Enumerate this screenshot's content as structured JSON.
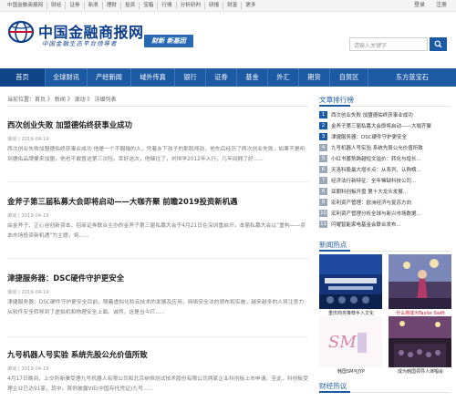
{
  "topbar": {
    "links": [
      "中国金融商报网",
      "财经",
      "证券",
      "新浪",
      "理财",
      "投资",
      "宝箱",
      "行情",
      "分析研判",
      "研报",
      "财富",
      "更多"
    ],
    "login": "登录",
    "register": "注册"
  },
  "header": {
    "site_name": "中国金融商报网",
    "slogan": "中国金融生态平台领导者",
    "badge": "财新 新基因",
    "search_placeholder": "请输入关键字"
  },
  "nav": {
    "items": [
      "首页",
      "全球财讯",
      "产经新闻",
      "域外传真",
      "银行",
      "证券",
      "基金",
      "外汇",
      "期货",
      "自贸区",
      "东方蓝宝石"
    ],
    "active_index": 0
  },
  "breadcrumb": "当前位置：首页 》 新闻 》 滚动 》 详细列表",
  "articles": [
    {
      "title": "西次创业失败 加盟德佑终获事业成功",
      "meta": "滚动 | 2019-04-19",
      "excerpt": "西次创业失败加盟德佑终获事业成功 他是一个不服输的人，凭着乡下孩子的那股闯劲，他先后经历了两次创业失败，如果不是听到德佑品牌要来加盟，他也不敢冒这第三次险。幸好这次，他赌住了，刘恒学2012年入行，几年间拥了好......"
    },
    {
      "title": "金斧子第三届私募大会即将启动——大咖齐聚 前瞻2019投资新机遇",
      "meta": "滚动 | 2019-04-19",
      "excerpt": "由金斧子、正心谷创新资本、招商证券联合主办的金斧子第三届私募大会于4月21日在深圳重启开。本届私募大会以“重构——资本市场投资新机遇”为主题，将......"
    },
    {
      "title": "津捷服务器：DSC硬件守护更安全",
      "meta": "滚动 | 2019-04-19",
      "excerpt": "津捷服务器：DSC硬件守护更安全目前，随着虚拟化和云技术的发展及应用，网络安全法的颁布和实施，越来越多的人将注意力从软件安全转移到了虚拟机和物理安全上面。诚然，这是当今IT......"
    },
    {
      "title": "九号机器人号实验 系统先股公允价值所致",
      "meta": "滚动 | 2019-04-19",
      "excerpt": "4月17日晚间，上交所新雅受理九号机器人有限公司和北京纳恒测试技术股份有限公司两家企业科创板上市申请。至此，科创板受理企业已达91家，其中，首例披露VIE(中国存托凭证)九号......"
    }
  ],
  "sidebar": {
    "rank_title": "文章排行榜",
    "rank": [
      "西次创业失败 加盟德佑终获事业成功",
      "金斧子第三届私募大会即将启动——大咖齐聚",
      "津捷服务器：DSC硬件守护更安全",
      "九号机器人号实验 系统先股公允价值所致",
      "小红书蓄势跨越短文溢价：转化与增长...",
      "天洛科股最大增长点：从系列、认购榜...",
      "经济法行新特征：全年稀缺科技公司...",
      "亚朝科创板开盘 第十大龙头发展...",
      "宏利资产管理：欧洲经济与复苏方向",
      "宏利资产管理分析全球与新兴市场数据...",
      "闪耀智能家电基金会联合发布..."
    ],
    "photo_title": "新闻热点",
    "photos": [
      {
        "caption": "重庆商务推荐手入文化"
      },
      {
        "caption": "什么将成为Taylor Swift"
      },
      {
        "caption": "韩国SM与JYP"
      },
      {
        "caption": "成为韩国领导人演唱会"
      }
    ],
    "bottom_title": "财经热议"
  },
  "colors": {
    "brand": "#1d5aa4",
    "nav_active": "#0f4489"
  }
}
